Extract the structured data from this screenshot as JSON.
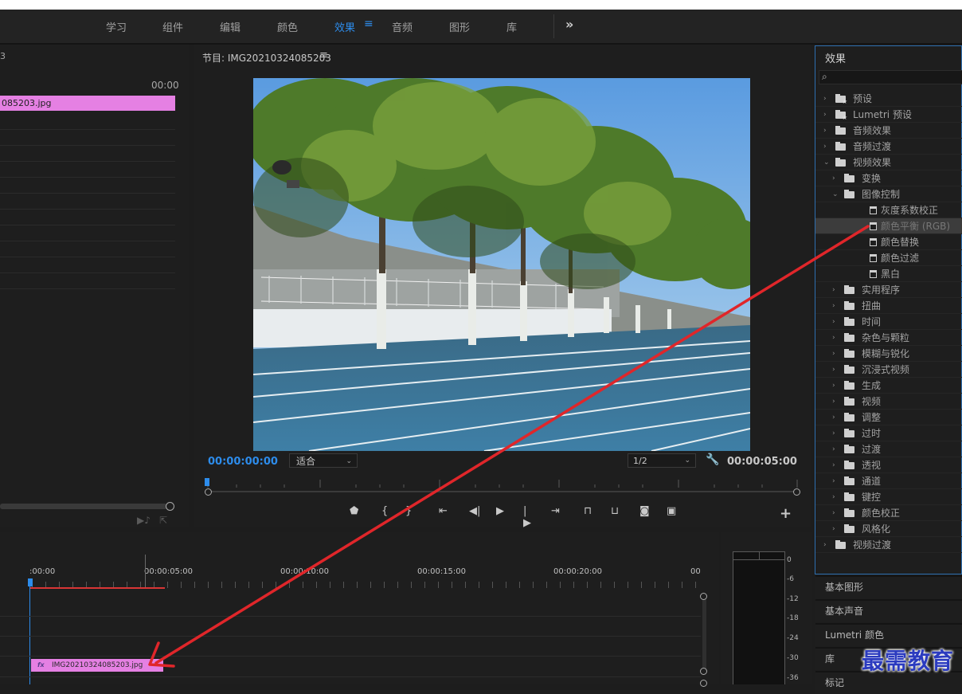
{
  "workspace": {
    "tabs": [
      "学习",
      "组件",
      "编辑",
      "颜色",
      "效果",
      "音频",
      "图形",
      "库"
    ],
    "active_tab": "效果",
    "menu_icon": "hamburger-icon",
    "more_icon": "double-chevron-right-icon",
    "accent_color": "#2d8ceb"
  },
  "source": {
    "title_fragment": "3",
    "timecode": "00:00",
    "clip_name": "085203.jpg",
    "clip_color": "#e580e3"
  },
  "program": {
    "title": "节目: IMG20210324085203",
    "menu_glyph": "≡",
    "timecode_current": "00:00:00:00",
    "fit": "适合",
    "resolution": "1/2",
    "timecode_duration": "00:00:05:00",
    "add_glyph": "+"
  },
  "effects": {
    "title": "效果",
    "search_icon": "search-icon",
    "tree": [
      {
        "label": "预设",
        "depth": 0,
        "kind": "folder-star",
        "arrow": "›"
      },
      {
        "label": "Lumetri 预设",
        "depth": 0,
        "kind": "folder-star",
        "arrow": "›"
      },
      {
        "label": "音频效果",
        "depth": 0,
        "kind": "folder",
        "arrow": "›"
      },
      {
        "label": "音频过渡",
        "depth": 0,
        "kind": "folder",
        "arrow": "›"
      },
      {
        "label": "视频效果",
        "depth": 0,
        "kind": "folder",
        "arrow": "⌄"
      },
      {
        "label": "变换",
        "depth": 1,
        "kind": "folder",
        "arrow": "›"
      },
      {
        "label": "图像控制",
        "depth": 1,
        "kind": "folder",
        "arrow": "⌄"
      },
      {
        "label": "灰度系数校正",
        "depth": 2,
        "kind": "effect",
        "arrow": ""
      },
      {
        "label": "颜色平衡 (RGB)",
        "depth": 2,
        "kind": "effect",
        "arrow": "",
        "selected": true
      },
      {
        "label": "颜色替换",
        "depth": 2,
        "kind": "effect",
        "arrow": ""
      },
      {
        "label": "颜色过滤",
        "depth": 2,
        "kind": "effect",
        "arrow": ""
      },
      {
        "label": "黑白",
        "depth": 2,
        "kind": "effect",
        "arrow": ""
      },
      {
        "label": "实用程序",
        "depth": 1,
        "kind": "folder",
        "arrow": "›"
      },
      {
        "label": "扭曲",
        "depth": 1,
        "kind": "folder",
        "arrow": "›"
      },
      {
        "label": "时间",
        "depth": 1,
        "kind": "folder",
        "arrow": "›"
      },
      {
        "label": "杂色与颗粒",
        "depth": 1,
        "kind": "folder",
        "arrow": "›"
      },
      {
        "label": "模糊与锐化",
        "depth": 1,
        "kind": "folder",
        "arrow": "›"
      },
      {
        "label": "沉浸式视频",
        "depth": 1,
        "kind": "folder",
        "arrow": "›"
      },
      {
        "label": "生成",
        "depth": 1,
        "kind": "folder",
        "arrow": "›"
      },
      {
        "label": "视频",
        "depth": 1,
        "kind": "folder",
        "arrow": "›"
      },
      {
        "label": "调整",
        "depth": 1,
        "kind": "folder",
        "arrow": "›"
      },
      {
        "label": "过时",
        "depth": 1,
        "kind": "folder",
        "arrow": "›"
      },
      {
        "label": "过渡",
        "depth": 1,
        "kind": "folder",
        "arrow": "›"
      },
      {
        "label": "透视",
        "depth": 1,
        "kind": "folder",
        "arrow": "›"
      },
      {
        "label": "通道",
        "depth": 1,
        "kind": "folder",
        "arrow": "›"
      },
      {
        "label": "键控",
        "depth": 1,
        "kind": "folder",
        "arrow": "›"
      },
      {
        "label": "颜色校正",
        "depth": 1,
        "kind": "folder",
        "arrow": "›"
      },
      {
        "label": "风格化",
        "depth": 1,
        "kind": "folder",
        "arrow": "›"
      },
      {
        "label": "视频过渡",
        "depth": 0,
        "kind": "folder",
        "arrow": "›"
      }
    ]
  },
  "side_panels": [
    "基本图形",
    "基本声音",
    "Lumetri 颜色",
    "库",
    "标记"
  ],
  "timeline": {
    "labels": [
      ":00:00",
      "00:00:05:00",
      "00:00:10:00",
      "00:00:15:00",
      "00:00:20:00",
      "00"
    ],
    "clip_name": "IMG20210324085203.jpg",
    "clip_fx": "fx"
  },
  "meter": {
    "db_labels": [
      "0",
      "-6",
      "-12",
      "-18",
      "-24",
      "-30",
      "-36"
    ]
  },
  "watermark": "最需教育",
  "annotation_color": "#e0262a"
}
